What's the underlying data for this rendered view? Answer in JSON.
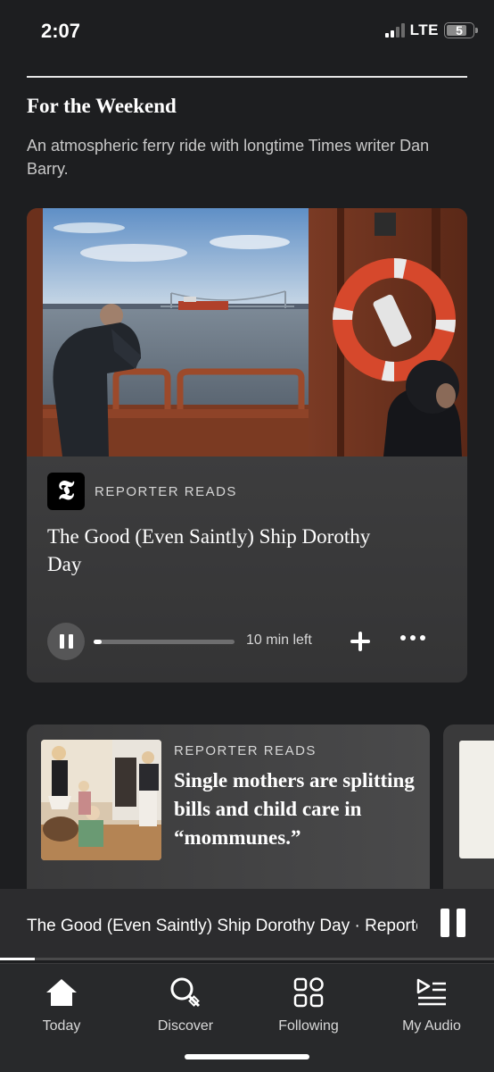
{
  "status_bar": {
    "time": "2:07",
    "network": "LTE",
    "battery": "5"
  },
  "section": {
    "title": "For the Weekend",
    "description": "An atmospheric ferry ride with longtime Times writer Dan Barry."
  },
  "main_card": {
    "kicker": "REPORTER READS",
    "headline": "The Good (Even Saintly) Ship Dorothy Day",
    "time_left": "10 min left",
    "progress": 0.06,
    "logo_letter": "𝕿"
  },
  "second_card": {
    "kicker": "REPORTER READS",
    "headline": "Single mothers are splitting bills and child care in “mommunes.”"
  },
  "mini_player": {
    "title": "The Good (Even Saintly) Ship Dorothy Day · Reporter Reads",
    "progress": 0.07
  },
  "tabs": [
    {
      "label": "Today",
      "icon": "home-icon"
    },
    {
      "label": "Discover",
      "icon": "search-icon"
    },
    {
      "label": "Following",
      "icon": "grid-icon"
    },
    {
      "label": "My Audio",
      "icon": "playlist-icon"
    }
  ],
  "colors": {
    "background": "#1d1e20",
    "card": "#3a3a3b",
    "text": "#ffffff",
    "muted": "#c9c9c9"
  }
}
